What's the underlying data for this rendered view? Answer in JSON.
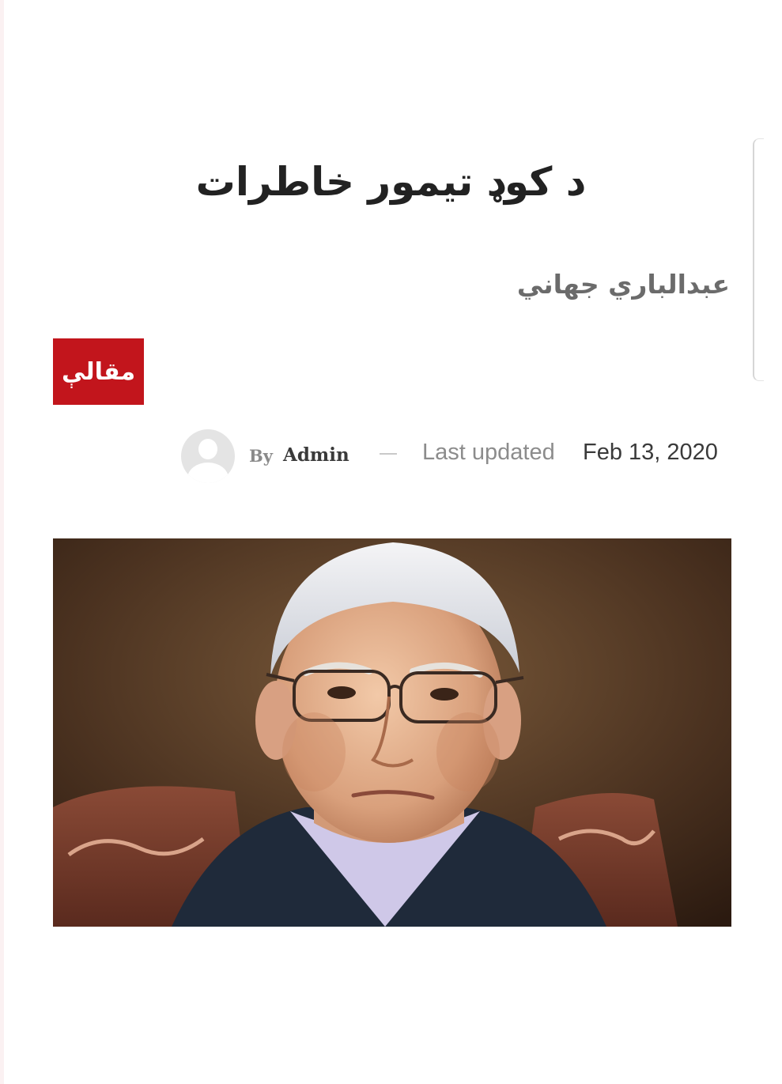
{
  "article": {
    "title": "د کوډ تیمور خاطرات",
    "author_name": "عبدالباري جهاني",
    "category": "مقالې"
  },
  "meta": {
    "by_label": "By",
    "author": "Admin",
    "updated_label": "Last updated",
    "updated_date": "Feb 13, 2020"
  },
  "featured_image": {
    "subject": "painted-portrait"
  },
  "colors": {
    "accent": "#c2151c",
    "title": "#222222",
    "muted": "#8c8c8c"
  }
}
